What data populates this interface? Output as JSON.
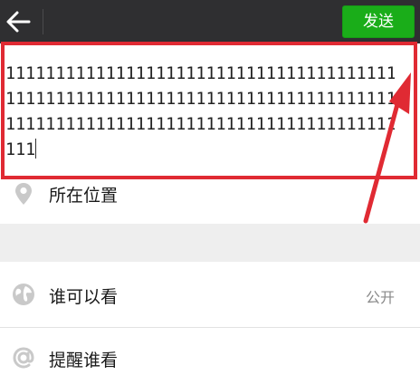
{
  "header": {
    "back_icon": "arrow-left-icon",
    "send_label": "发送",
    "send_color": "#1aad19",
    "bar_color": "#2f2f31"
  },
  "editor": {
    "lines": [
      "111111111111111111111111111111111111111",
      "111111111111111111111111111111111111111",
      "111111111111111111111111111111111111111",
      "111"
    ]
  },
  "annotation": {
    "box_color": "#e02a33",
    "arrow_color": "#e02a33"
  },
  "rows": {
    "location": {
      "icon": "location-pin-icon",
      "label": "所在位置"
    },
    "visibility": {
      "icon": "globe-icon",
      "label": "谁可以看",
      "value": "公开"
    },
    "mention": {
      "icon": "at-sign-icon",
      "label": "提醒谁看"
    }
  }
}
